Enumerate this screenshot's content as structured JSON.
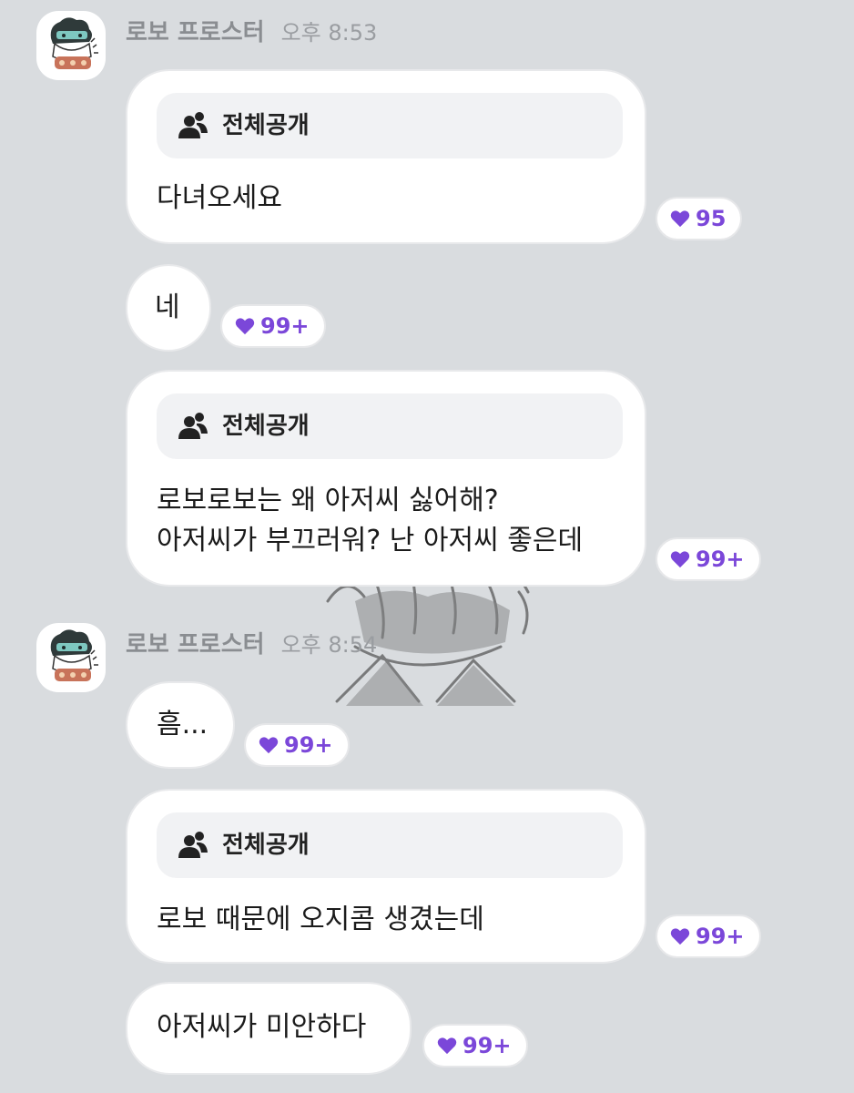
{
  "chat": {
    "groups": [
      {
        "sender": {
          "name": "로보 프로스터",
          "time": "오후 8:53"
        },
        "messages": [
          {
            "visibility": "전체공개",
            "lines": [
              "다녀오세요"
            ],
            "likes": "95"
          },
          {
            "lines": [
              "네"
            ],
            "likes": "99+"
          },
          {
            "visibility": "전체공개",
            "lines": [
              "로보로보는 왜 아저씨 싫어해?",
              "아저씨가 부끄러워? 난 아저씨 좋은데"
            ],
            "likes": "99+"
          }
        ]
      },
      {
        "sender": {
          "name": "로보 프로스터",
          "time": "오후 8:54"
        },
        "messages": [
          {
            "lines": [
              "흠..."
            ],
            "likes": "99+"
          },
          {
            "visibility": "전체공개",
            "lines": [
              "로보 때문에 오지콤 생겼는데"
            ],
            "likes": "99+"
          },
          {
            "lines": [
              "아저씨가 미안하다"
            ],
            "likes": "99+"
          }
        ]
      }
    ]
  },
  "icons": {
    "visibility": "people-icon",
    "like": "heart-icon",
    "avatar": "robot-avatar"
  },
  "colors": {
    "background": "#d9dcdf",
    "like_accent": "#7b47d9",
    "bubble": "#ffffff",
    "visibility_tag": "#f1f2f4"
  }
}
